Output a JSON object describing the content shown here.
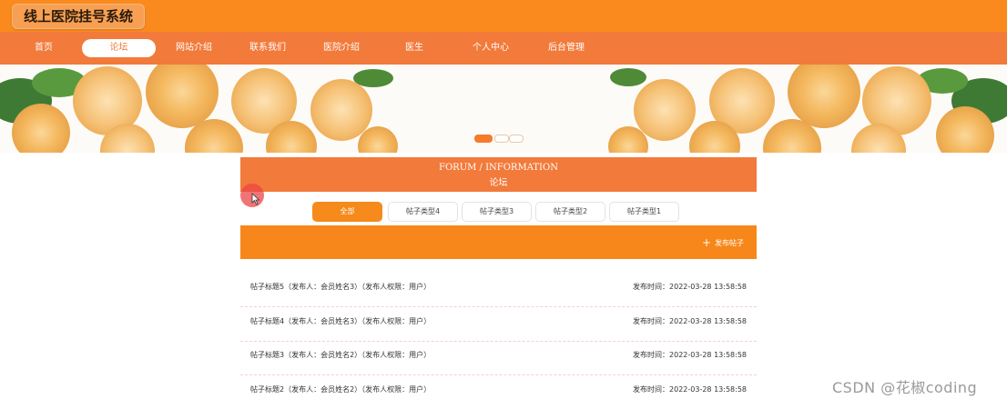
{
  "site": {
    "title": "线上医院挂号系统"
  },
  "nav": {
    "items": [
      {
        "label": "首页"
      },
      {
        "label": "论坛"
      },
      {
        "label": "网站介绍"
      },
      {
        "label": "联系我们"
      },
      {
        "label": "医院介绍"
      },
      {
        "label": "医生"
      },
      {
        "label": "个人中心"
      },
      {
        "label": "后台管理"
      }
    ],
    "active_index": 1
  },
  "banner": {
    "active_slide": 1,
    "slide_count": 3
  },
  "forum": {
    "title_en": "FORUM / INFORMATION",
    "title_cn": "论坛"
  },
  "tabs": [
    {
      "label": "全部",
      "active": true
    },
    {
      "label": "帖子类型4",
      "active": false
    },
    {
      "label": "帖子类型3",
      "active": false
    },
    {
      "label": "帖子类型2",
      "active": false
    },
    {
      "label": "帖子类型1",
      "active": false
    }
  ],
  "actions": {
    "post_label": "发布帖子",
    "post_icon": "plus-icon"
  },
  "posts": [
    {
      "title": "帖子标题5（发布人：会员姓名3）（发布人权限：用户）",
      "time": "发布时间：2022-03-28 13:58:58"
    },
    {
      "title": "帖子标题4（发布人：会员姓名3）（发布人权限：用户）",
      "time": "发布时间：2022-03-28 13:58:58"
    },
    {
      "title": "帖子标题3（发布人：会员姓名2）（发布人权限：用户）",
      "time": "发布时间：2022-03-28 13:58:58"
    },
    {
      "title": "帖子标题2（发布人：会员姓名2）（发布人权限：用户）",
      "time": "发布时间：2022-03-28 13:58:58"
    }
  ],
  "watermark": "CSDN @花椒coding",
  "colors": {
    "topbar": "#fb8a1e",
    "navbar": "#f27a3a",
    "accent": "#f68a1b",
    "header": "#f27a3a"
  }
}
